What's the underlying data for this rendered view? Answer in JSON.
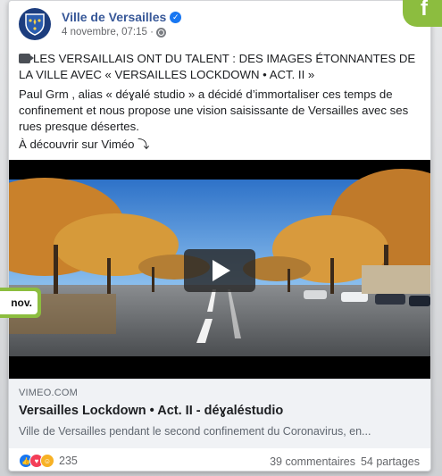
{
  "post": {
    "author": "Ville de Versailles",
    "timestamp": "4 novembre, 07:15 ·",
    "privacy_icon": "globe-icon",
    "verified_icon": "verified-badge-icon",
    "headline": "LES VERSAILLAIS ONT DU TALENT : DES IMAGES ÉTONNANTES DE LA VILLE AVEC « VERSAILLES LOCKDOWN • ACT. II »",
    "paragraph": "Paul Grm , alias « déɣalé studio » a décidé d’immortaliser ces temps de confinement et nous propose une vision saisissante de Versailles avec ses rues presque désertes.",
    "cta": "À découvrir sur Viméo ⤵"
  },
  "video": {
    "play_icon": "play-icon"
  },
  "link_preview": {
    "domain": "VIMEO.COM",
    "title": "Versailles Lockdown • Act. II - déɣaléstudio",
    "description": "Ville de Versailles pendant le second confinement du Coronavirus, en..."
  },
  "footer": {
    "reaction_count": "235",
    "comments": "39 commentaires",
    "shares": "54 partages"
  },
  "annotations": {
    "date_tag": "nov.",
    "corner_icon": "facebook-f-icon"
  },
  "colors": {
    "brand_blue": "#385898",
    "accent_green": "#8cbd3f",
    "like_blue": "#1877f2"
  }
}
